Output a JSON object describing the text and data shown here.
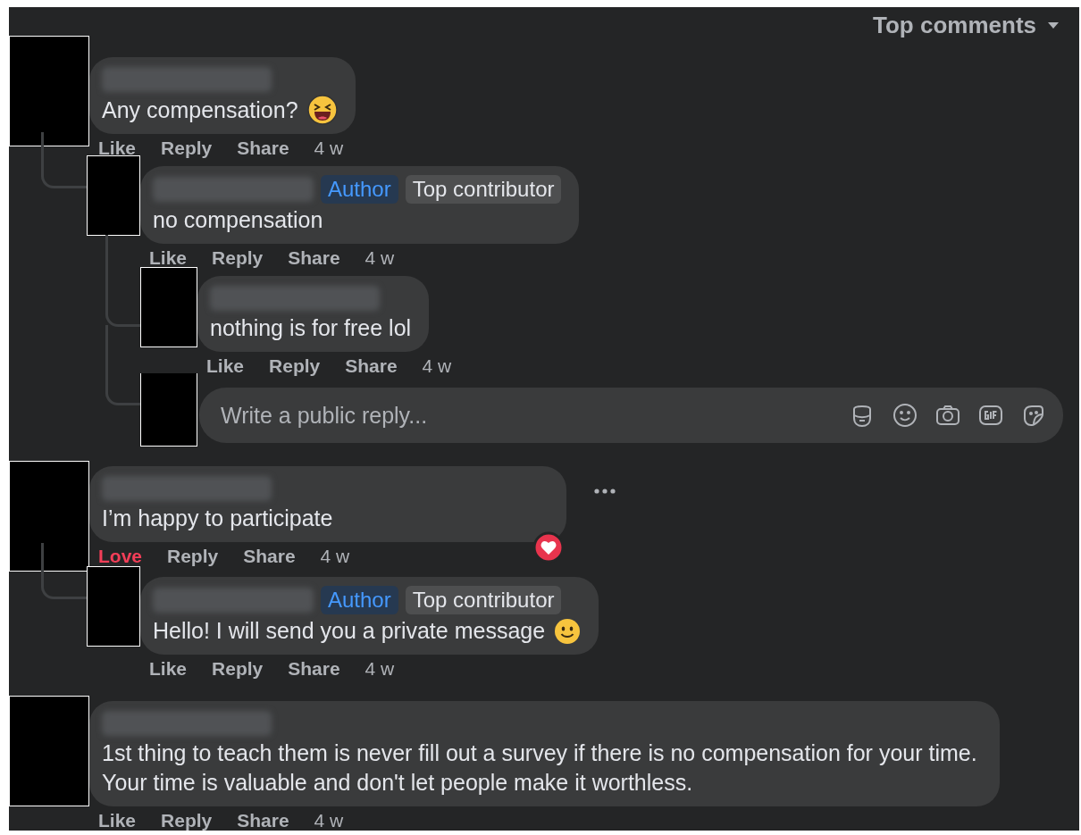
{
  "sort": {
    "label": "Top comments"
  },
  "comments": [
    {
      "text": "Any compensation?",
      "emoji": {
        "kind": "laughing"
      },
      "actions": [
        {
          "label": "Like",
          "selected": false
        },
        {
          "label": "Reply"
        },
        {
          "label": "Share"
        }
      ],
      "time": "4 w",
      "replies": [
        {
          "badges": [
            {
              "label": "Author",
              "kind": "author"
            },
            {
              "label": "Top contributor",
              "kind": "plain"
            }
          ],
          "text": "no compensation",
          "actions": [
            {
              "label": "Like",
              "selected": false
            },
            {
              "label": "Reply"
            },
            {
              "label": "Share"
            }
          ],
          "time": "4 w",
          "replies": [
            {
              "text": "nothing is for free lol",
              "actions": [
                {
                  "label": "Like",
                  "selected": false
                },
                {
                  "label": "Reply"
                },
                {
                  "label": "Share"
                }
              ],
              "time": "4 w"
            }
          ],
          "reply_box": {
            "placeholder": "Write a public reply..."
          }
        }
      ]
    },
    {
      "text": "I’m happy to participate",
      "reaction": {
        "kind": "love"
      },
      "more": true,
      "actions": [
        {
          "label": "Love",
          "selected": true
        },
        {
          "label": "Reply"
        },
        {
          "label": "Share"
        }
      ],
      "time": "4 w",
      "replies": [
        {
          "badges": [
            {
              "label": "Author",
              "kind": "author"
            },
            {
              "label": "Top contributor",
              "kind": "plain"
            }
          ],
          "text": "Hello! I will send you a private message",
          "emoji": {
            "kind": "smile"
          },
          "actions": [
            {
              "label": "Like",
              "selected": false
            },
            {
              "label": "Reply"
            },
            {
              "label": "Share"
            }
          ],
          "time": "4 w"
        }
      ]
    },
    {
      "text": "1st thing to teach them is never fill out a survey if there is no compensation for your time. Your time is valuable and don't let people make it worthless.",
      "actions": [
        {
          "label": "Like",
          "selected": false
        },
        {
          "label": "Reply"
        },
        {
          "label": "Share"
        }
      ],
      "time": "4 w"
    }
  ]
}
